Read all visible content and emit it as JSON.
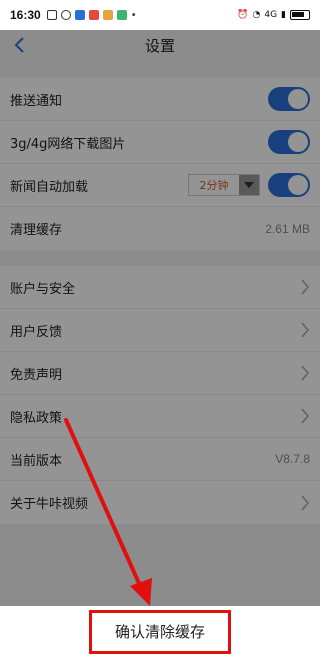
{
  "status_bar": {
    "time": "16:30",
    "icons": [
      "notification-icon",
      "message-icon",
      "app-icon",
      "app-icon",
      "app-icon",
      "app-icon",
      "more-dot"
    ],
    "more": "•",
    "network": "4G",
    "battery": "battery-icon"
  },
  "nav": {
    "title": "设置",
    "back_icon": "back-arrow-icon"
  },
  "group1": [
    {
      "label": "推送通知",
      "control": "toggle",
      "on": true
    },
    {
      "label": "3g/4g网络下载图片",
      "control": "toggle",
      "on": true
    },
    {
      "label": "新闻自动加载",
      "control": "select+toggle",
      "select_value": "2分钟",
      "on": true
    },
    {
      "label": "清理缓存",
      "value": "2.61 MB"
    }
  ],
  "group2": [
    {
      "label": "账户与安全"
    },
    {
      "label": "用户反馈"
    },
    {
      "label": "免责声明"
    },
    {
      "label": "隐私政策"
    },
    {
      "label": "当前版本",
      "value": "V8.7.8"
    },
    {
      "label": "关于牛咔视频"
    }
  ],
  "dialog": {
    "confirm_label": "确认清除缓存"
  },
  "colors": {
    "toggle_on": "#2a6fd6",
    "annotation": "#e01010",
    "select_text": "#c85a2b"
  }
}
